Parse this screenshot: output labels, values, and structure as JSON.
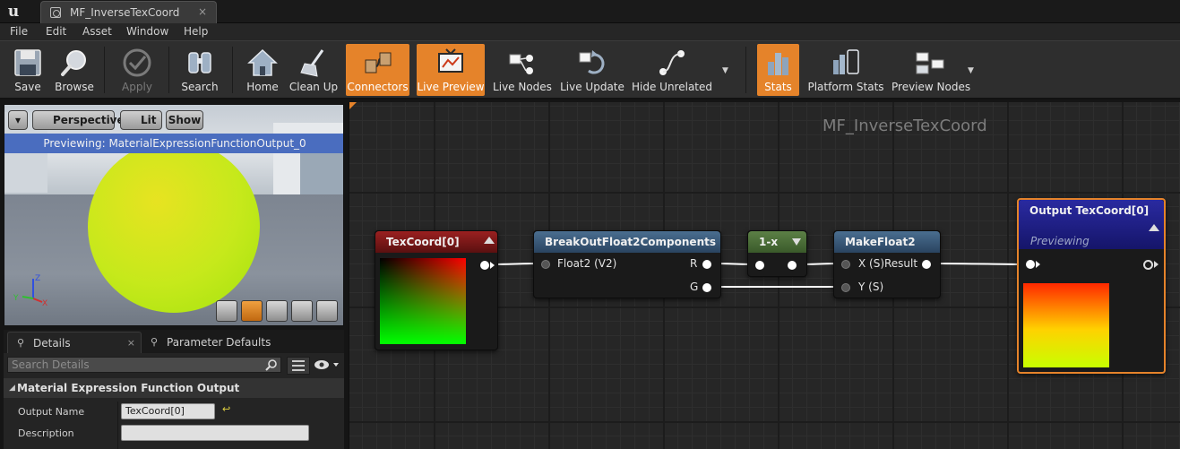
{
  "window": {
    "tab_title": "MF_InverseTexCoord",
    "tab_close": "×",
    "logo": "u"
  },
  "menu": [
    "File",
    "Edit",
    "Asset",
    "Window",
    "Help"
  ],
  "toolbar": {
    "buttons": [
      {
        "label": "Save",
        "icon": "save-icon",
        "state": "normal"
      },
      {
        "label": "Browse",
        "icon": "magnifier-icon",
        "state": "normal"
      },
      {
        "label": "Apply",
        "icon": "checkmark-icon",
        "state": "disabled"
      },
      {
        "label": "Search",
        "icon": "binoculars-icon",
        "state": "normal"
      },
      {
        "label": "Home",
        "icon": "house-icon",
        "state": "normal"
      },
      {
        "label": "Clean Up",
        "icon": "broom-icon",
        "state": "normal"
      },
      {
        "label": "Connectors",
        "icon": "connectors-icon",
        "state": "active"
      },
      {
        "label": "Live Preview",
        "icon": "monitor-icon",
        "state": "active"
      },
      {
        "label": "Live Nodes",
        "icon": "live-nodes-icon",
        "state": "normal"
      },
      {
        "label": "Live Update",
        "icon": "live-update-icon",
        "state": "normal"
      },
      {
        "label": "Hide Unrelated",
        "icon": "hide-unrelated-icon",
        "state": "normal"
      },
      {
        "label": "Stats",
        "icon": "stats-icon",
        "state": "active"
      },
      {
        "label": "Platform Stats",
        "icon": "platform-stats-icon",
        "state": "normal"
      },
      {
        "label": "Preview Nodes",
        "icon": "preview-nodes-icon",
        "state": "normal"
      }
    ],
    "accent": "#e5832a"
  },
  "viewport": {
    "perspective_label": "Perspective",
    "lit_label": "Lit",
    "show_label": "Show",
    "banner": "Previewing: MaterialExpressionFunctionOutput_0",
    "banner_color": "#4a6dbf",
    "gizmo": {
      "z": "Z",
      "x": "X",
      "y": "Y"
    }
  },
  "details": {
    "tabs": [
      {
        "label": "Details",
        "active": true
      },
      {
        "label": "Parameter Defaults",
        "active": false
      }
    ],
    "search_placeholder": "Search Details",
    "category": "Material Expression Function Output",
    "rows": [
      {
        "key": "Output Name",
        "value": "TexCoord[0]"
      },
      {
        "key": "Description",
        "value": ""
      }
    ]
  },
  "graph": {
    "title": "MF_InverseTexCoord",
    "nodes": {
      "texcoord": {
        "title": "TexCoord[0]",
        "color": "#8a1818"
      },
      "breakout": {
        "title": "BreakOutFloat2Components",
        "color": "#3a5a78",
        "inputs": [
          "Float2 (V2)"
        ],
        "outputs": [
          "R",
          "G"
        ]
      },
      "oneminus": {
        "title": "1-x",
        "color": "#4a6e3a"
      },
      "makefloat": {
        "title": "MakeFloat2",
        "color": "#3a5a78",
        "inputs": [
          "X (S)",
          "Y (S)"
        ],
        "outputs": [
          "Result"
        ]
      },
      "output": {
        "title": "Output TexCoord[0]",
        "subtitle": "Previewing",
        "color": "#1c1c7c",
        "border": "#e5832a"
      }
    }
  }
}
